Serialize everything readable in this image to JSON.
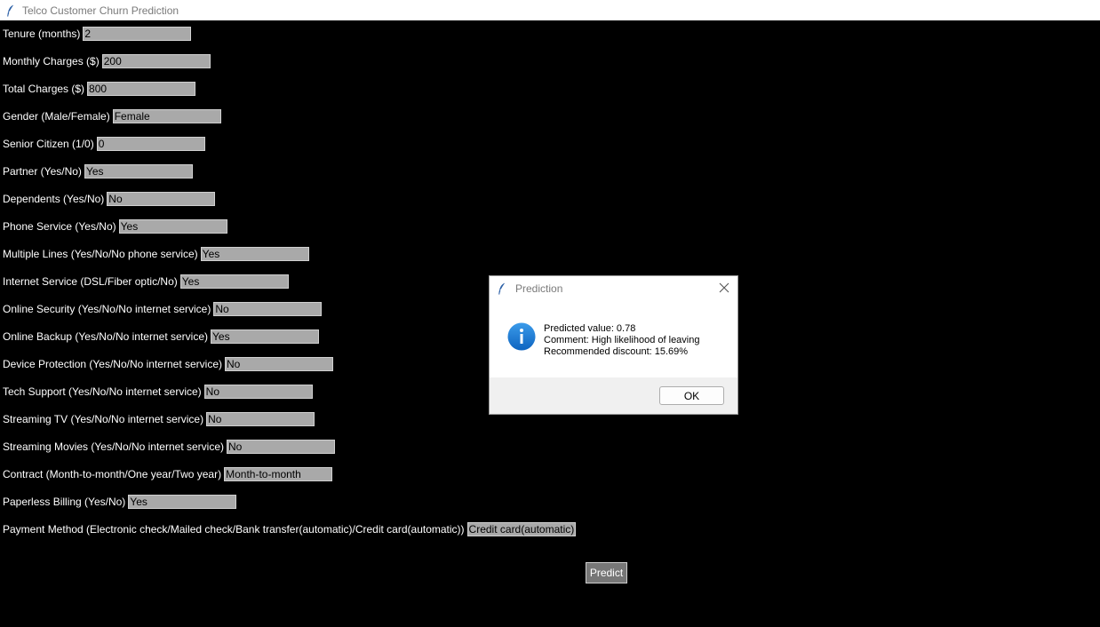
{
  "window": {
    "title": "Telco Customer Churn Prediction"
  },
  "form": {
    "fields": [
      {
        "label": "Tenure (months)",
        "value": "2"
      },
      {
        "label": "Monthly Charges ($)",
        "value": "200"
      },
      {
        "label": "Total Charges ($)",
        "value": "800"
      },
      {
        "label": "Gender (Male/Female)",
        "value": "Female"
      },
      {
        "label": "Senior Citizen (1/0)",
        "value": "0"
      },
      {
        "label": "Partner (Yes/No)",
        "value": "Yes"
      },
      {
        "label": "Dependents (Yes/No)",
        "value": "No"
      },
      {
        "label": "Phone Service (Yes/No)",
        "value": "Yes"
      },
      {
        "label": "Multiple Lines (Yes/No/No phone service)",
        "value": "Yes"
      },
      {
        "label": "Internet Service (DSL/Fiber optic/No)",
        "value": "Yes"
      },
      {
        "label": "Online Security (Yes/No/No internet service)",
        "value": "No"
      },
      {
        "label": "Online Backup (Yes/No/No internet service)",
        "value": "Yes"
      },
      {
        "label": "Device Protection (Yes/No/No internet service)",
        "value": "No"
      },
      {
        "label": "Tech Support (Yes/No/No internet service)",
        "value": "No"
      },
      {
        "label": "Streaming TV (Yes/No/No internet service)",
        "value": "No"
      },
      {
        "label": "Streaming Movies (Yes/No/No internet service)",
        "value": "No"
      },
      {
        "label": "Contract (Month-to-month/One year/Two year)",
        "value": "Month-to-month"
      },
      {
        "label": "Paperless Billing (Yes/No)",
        "value": "Yes"
      },
      {
        "label": "Payment Method (Electronic check/Mailed check/Bank transfer(automatic)/Credit card(automatic))",
        "value": "Credit card(automatic)"
      }
    ],
    "predict_label": "Predict"
  },
  "dialog": {
    "title": "Prediction",
    "lines": [
      "Predicted value: 0.78",
      "Comment: High likelihood of leaving",
      "Recommended discount: 15.69%"
    ],
    "ok_label": "OK",
    "icon": "info-icon"
  },
  "colors": {
    "background": "#000000",
    "input_bg": "#a9a9a9",
    "button_bg": "#777777",
    "info_blue": "#1a7fd4"
  }
}
